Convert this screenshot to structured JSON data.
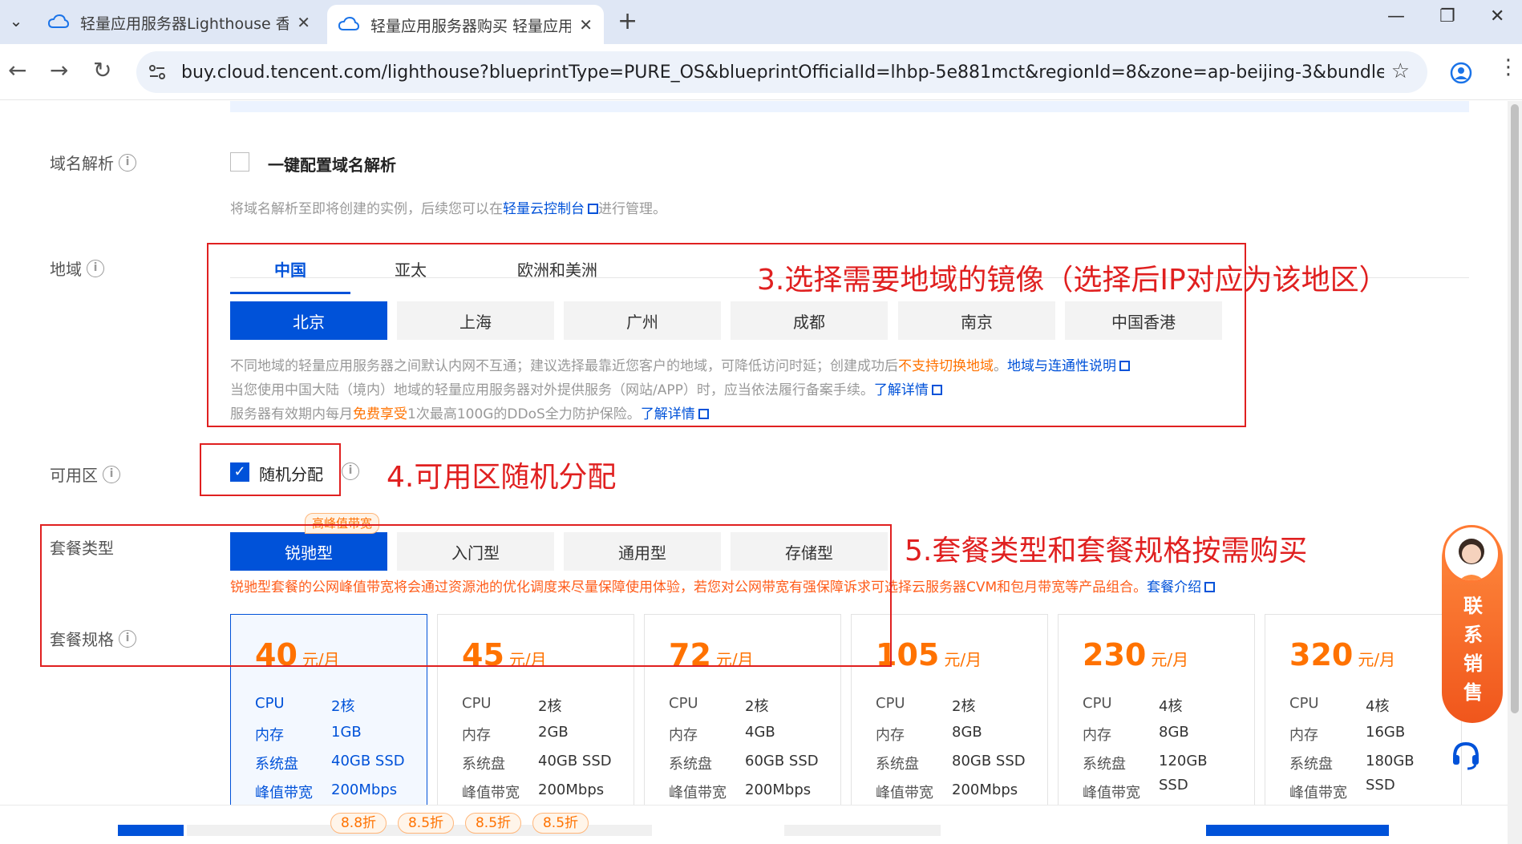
{
  "browser": {
    "tabs": [
      {
        "title": "轻量应用服务器Lighthouse 香",
        "active": false
      },
      {
        "title": "轻量应用服务器购买 轻量应用服",
        "active": true
      }
    ],
    "url": "buy.cloud.tencent.com/lighthouse?blueprintType=PURE_OS&blueprintOfficialId=lhbp-5e881mct&regionId=8&zone=ap-beijing-3&bundleId=bun..."
  },
  "domain_resolution": {
    "label": "域名解析",
    "checkbox_label": "一键配置域名解析",
    "checked": false,
    "hint_prefix": "将域名解析至即将创建的实例，后续您可以在",
    "hint_link": "轻量云控制台",
    "hint_suffix": "进行管理。"
  },
  "region": {
    "label": "地域",
    "tabs": [
      "中国",
      "亚太",
      "欧洲和美洲"
    ],
    "selected_tab": "中国",
    "cities": [
      "北京",
      "上海",
      "广州",
      "成都",
      "南京",
      "中国香港"
    ],
    "selected_city": "北京",
    "hint1_prefix": "不同地域的轻量应用服务器之间默认内网不互通；建议选择最靠近您客户的地域，可降低访问时延；创建成功后",
    "hint1_warn": "不支持切换地域",
    "hint1_dot": "。",
    "hint1_link": "地域与连通性说明",
    "hint2_text": "当您使用中国大陆（境内）地域的轻量应用服务器对外提供服务（网站/APP）时，应当依法履行备案手续。",
    "hint2_link": "了解详情",
    "hint3_prefix": "服务器有效期内每月",
    "hint3_warn": "免费享受",
    "hint3_text": "1次最高100G的DDoS全力防护保险。",
    "hint3_link": "了解详情"
  },
  "zone": {
    "label": "可用区",
    "checkbox_label": "随机分配",
    "checked": true
  },
  "package_type": {
    "label": "套餐类型",
    "badge": "高峰值带宽",
    "options": [
      "锐驰型",
      "入门型",
      "通用型",
      "存储型"
    ],
    "selected": "锐驰型",
    "note": "锐驰型套餐的公网峰值带宽将会通过资源池的优化调度来尽量保障使用体验，若您对公网带宽有强保障诉求可选择云服务器CVM和包月带宽等产品组合。",
    "note_link": "套餐介绍"
  },
  "package_spec": {
    "label": "套餐规格",
    "unit": "元/月",
    "spec_labels": {
      "cpu": "CPU",
      "mem": "内存",
      "disk": "系统盘",
      "bw": "峰值带宽"
    },
    "plans": [
      {
        "price": "40",
        "cpu": "2核",
        "mem": "1GB",
        "disk": "40GB SSD",
        "bw": "200Mbps",
        "selected": true
      },
      {
        "price": "45",
        "cpu": "2核",
        "mem": "2GB",
        "disk": "40GB SSD",
        "bw": "200Mbps",
        "selected": false
      },
      {
        "price": "72",
        "cpu": "2核",
        "mem": "4GB",
        "disk": "60GB SSD",
        "bw": "200Mbps",
        "selected": false
      },
      {
        "price": "105",
        "cpu": "2核",
        "mem": "8GB",
        "disk": "80GB SSD",
        "bw": "200Mbps",
        "selected": false
      },
      {
        "price": "230",
        "cpu": "4核",
        "mem": "8GB",
        "disk": "120GB",
        "disk2": "SSD",
        "bw": "",
        "selected": false
      },
      {
        "price": "320",
        "cpu": "4核",
        "mem": "16GB",
        "disk": "180GB",
        "disk2": "SSD",
        "bw": "",
        "selected": false
      }
    ]
  },
  "discounts": [
    "8.8折",
    "8.5折",
    "8.5折",
    "8.5折"
  ],
  "annotations": {
    "step3": "3.选择需要地域的镜像（选择后IP对应为该地区）",
    "step4": "4.可用区随机分配",
    "step5": "5.套餐类型和套餐规格按需购买"
  },
  "contact": {
    "label": "联系销售"
  },
  "colors": {
    "primary": "#0052d9",
    "price": "#ff7200",
    "annotation": "#e02020"
  }
}
